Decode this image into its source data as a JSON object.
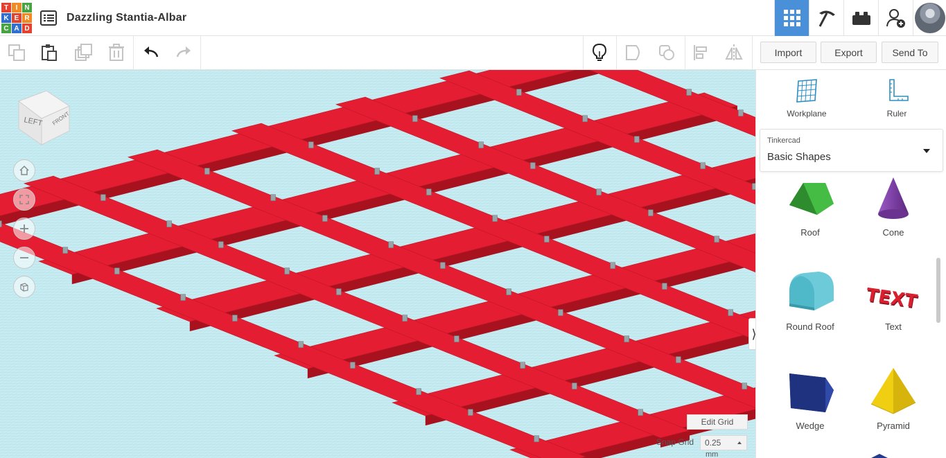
{
  "header": {
    "logo_letters": [
      "T",
      "I",
      "N",
      "K",
      "E",
      "R",
      "C",
      "A",
      "D"
    ],
    "logo_colors": [
      "#e5412f",
      "#f18a23",
      "#48a342",
      "#2f6fd1",
      "#e5412f",
      "#f18a23",
      "#48a342",
      "#2f6fd1",
      "#e5412f"
    ],
    "design_title": "Dazzling Stantia-Albar",
    "views": [
      "grid-view-icon",
      "pickaxe-icon",
      "brick-icon",
      "add-user-icon"
    ],
    "active_view": "grid-view-icon"
  },
  "toolbar": {
    "tools_left": [
      "copy-icon",
      "paste-icon",
      "duplicate-icon",
      "delete-icon",
      "undo-icon",
      "redo-icon"
    ],
    "tools_right": [
      "lightbulb-icon",
      "shape-icon",
      "hole-icon",
      "align-icon",
      "mirror-icon"
    ],
    "import_label": "Import",
    "export_label": "Export",
    "send_to_label": "Send To"
  },
  "viewport": {
    "view_cube": {
      "left_label": "LEFT",
      "front_label": "FRONT"
    },
    "nav_buttons": [
      "home-icon",
      "fit-icon",
      "zoom-in-icon",
      "zoom-out-icon",
      "perspective-icon"
    ],
    "edit_grid_label": "Edit Grid",
    "snap_grid_label": "Snap Grid",
    "snap_grid_value": "0.25",
    "snap_grid_unit": "mm",
    "colors": {
      "grid": "#c7ecf2",
      "shape": "#e41d32",
      "shape_dark": "#a8121f",
      "shape_side": "#c4182a"
    }
  },
  "panel": {
    "workplane_label": "Workplane",
    "ruler_label": "Ruler",
    "library_sub": "Tinkercad",
    "library_name": "Basic Shapes",
    "shapes": [
      {
        "label": "Roof",
        "icon": "roof-icon",
        "color": "#3aa83a"
      },
      {
        "label": "Cone",
        "icon": "cone-icon",
        "color": "#7c3fa3"
      },
      {
        "label": "Round Roof",
        "icon": "round-roof-icon",
        "color": "#4fb8c9"
      },
      {
        "label": "Text",
        "icon": "text-shape-icon",
        "color": "#d9202f"
      },
      {
        "label": "Wedge",
        "icon": "wedge-icon",
        "color": "#233b8f"
      },
      {
        "label": "Pyramid",
        "icon": "pyramid-icon",
        "color": "#f0cf13"
      }
    ]
  }
}
